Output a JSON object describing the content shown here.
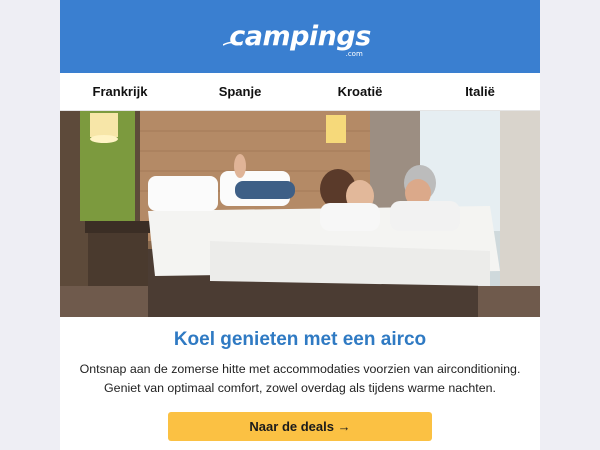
{
  "header": {
    "logo_text": "campings",
    "logo_suffix": ".com",
    "brand_color": "#3a7fd0",
    "logo_accent_color": "#f6c95a"
  },
  "nav": {
    "items": [
      {
        "label": "Frankrijk"
      },
      {
        "label": "Spanje"
      },
      {
        "label": "Kroatië"
      },
      {
        "label": "Italië"
      }
    ]
  },
  "hero": {
    "icon": "hotel-room-family-photo"
  },
  "content": {
    "title": "Koel genieten met een airco",
    "body": "Ontsnap aan de zomerse hitte met accommodaties voorzien van airconditioning. Geniet van optimaal comfort, zowel overdag als tijdens warme nachten.",
    "title_color": "#2f7ac3"
  },
  "cta": {
    "label": "Naar de deals →",
    "color": "#fbc143"
  }
}
